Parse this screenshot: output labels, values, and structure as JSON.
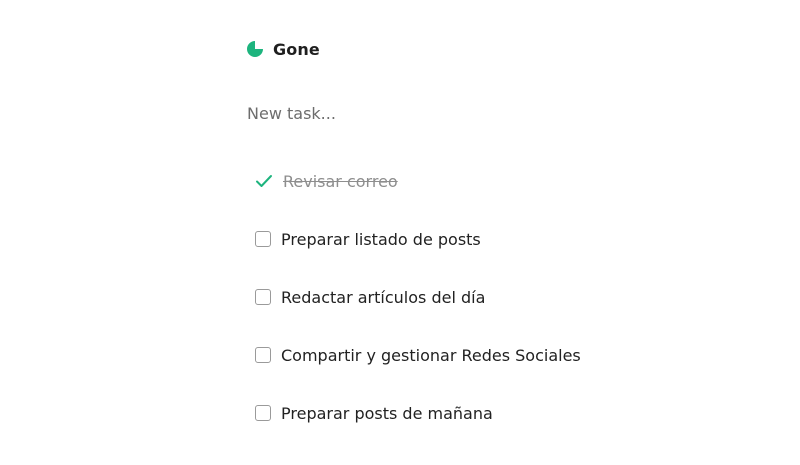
{
  "app": {
    "title": "Gone",
    "brand_color": "#1db47e"
  },
  "new_task": {
    "placeholder": "New task..."
  },
  "tasks": [
    {
      "label": "Revisar correo",
      "done": true
    },
    {
      "label": "Preparar listado de posts",
      "done": false
    },
    {
      "label": "Redactar artículos del día",
      "done": false
    },
    {
      "label": "Compartir y gestionar Redes Sociales",
      "done": false
    },
    {
      "label": "Preparar posts de mañana",
      "done": false
    }
  ],
  "icons": {
    "logo": "pie-logo-icon",
    "done": "check-icon",
    "pending": "checkbox"
  }
}
